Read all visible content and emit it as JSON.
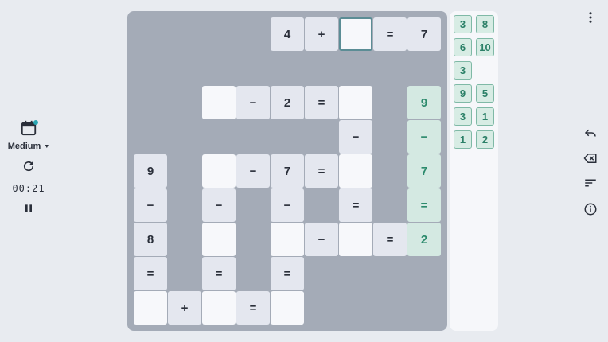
{
  "left": {
    "difficulty": "Medium",
    "timer": "00:21"
  },
  "board": {
    "cells": [
      {
        "text": "4",
        "type": "given"
      },
      {
        "text": "+",
        "type": "given"
      },
      {
        "text": "",
        "type": "selected"
      },
      {
        "text": "=",
        "type": "given"
      },
      {
        "text": "7",
        "type": "given"
      },
      {
        "text": "",
        "type": "input"
      },
      {
        "text": "−",
        "type": "given"
      },
      {
        "text": "2",
        "type": "given"
      },
      {
        "text": "=",
        "type": "given"
      },
      {
        "text": "",
        "type": "input"
      },
      {
        "text": "9",
        "type": "green"
      },
      {
        "text": "−",
        "type": "given"
      },
      {
        "text": "−",
        "type": "green"
      },
      {
        "text": "9",
        "type": "given"
      },
      {
        "text": "",
        "type": "input"
      },
      {
        "text": "−",
        "type": "given"
      },
      {
        "text": "7",
        "type": "given"
      },
      {
        "text": "=",
        "type": "given"
      },
      {
        "text": "",
        "type": "input"
      },
      {
        "text": "7",
        "type": "green"
      },
      {
        "text": "−",
        "type": "given"
      },
      {
        "text": "−",
        "type": "given"
      },
      {
        "text": "−",
        "type": "given"
      },
      {
        "text": "=",
        "type": "given"
      },
      {
        "text": "=",
        "type": "green"
      },
      {
        "text": "8",
        "type": "given"
      },
      {
        "text": "",
        "type": "input"
      },
      {
        "text": "",
        "type": "input"
      },
      {
        "text": "−",
        "type": "given"
      },
      {
        "text": "",
        "type": "input"
      },
      {
        "text": "=",
        "type": "given"
      },
      {
        "text": "2",
        "type": "green"
      },
      {
        "text": "=",
        "type": "given"
      },
      {
        "text": "=",
        "type": "given"
      },
      {
        "text": "=",
        "type": "given"
      },
      {
        "text": "",
        "type": "input"
      },
      {
        "text": "+",
        "type": "given"
      },
      {
        "text": "",
        "type": "input"
      },
      {
        "text": "=",
        "type": "given"
      },
      {
        "text": "",
        "type": "input"
      }
    ]
  },
  "tray": {
    "tiles": [
      "3",
      "8",
      "6",
      "10",
      "3",
      "9",
      "5",
      "3",
      "1",
      "1",
      "2"
    ]
  },
  "icons": {
    "calendar": "calendar-icon",
    "refresh": "refresh-icon",
    "pause": "pause-icon",
    "more": "more-vert-icon",
    "undo": "undo-icon",
    "backspace": "backspace-icon",
    "sort": "sort-icon",
    "info": "info-icon"
  },
  "colors": {
    "board": "#a4abb7",
    "given_cell": "#e4e7ef",
    "input_cell": "#f7f8fb",
    "solved_cell": "#d4e9e2",
    "tile": "#d7ece4",
    "accent": "#2aa7b3"
  }
}
